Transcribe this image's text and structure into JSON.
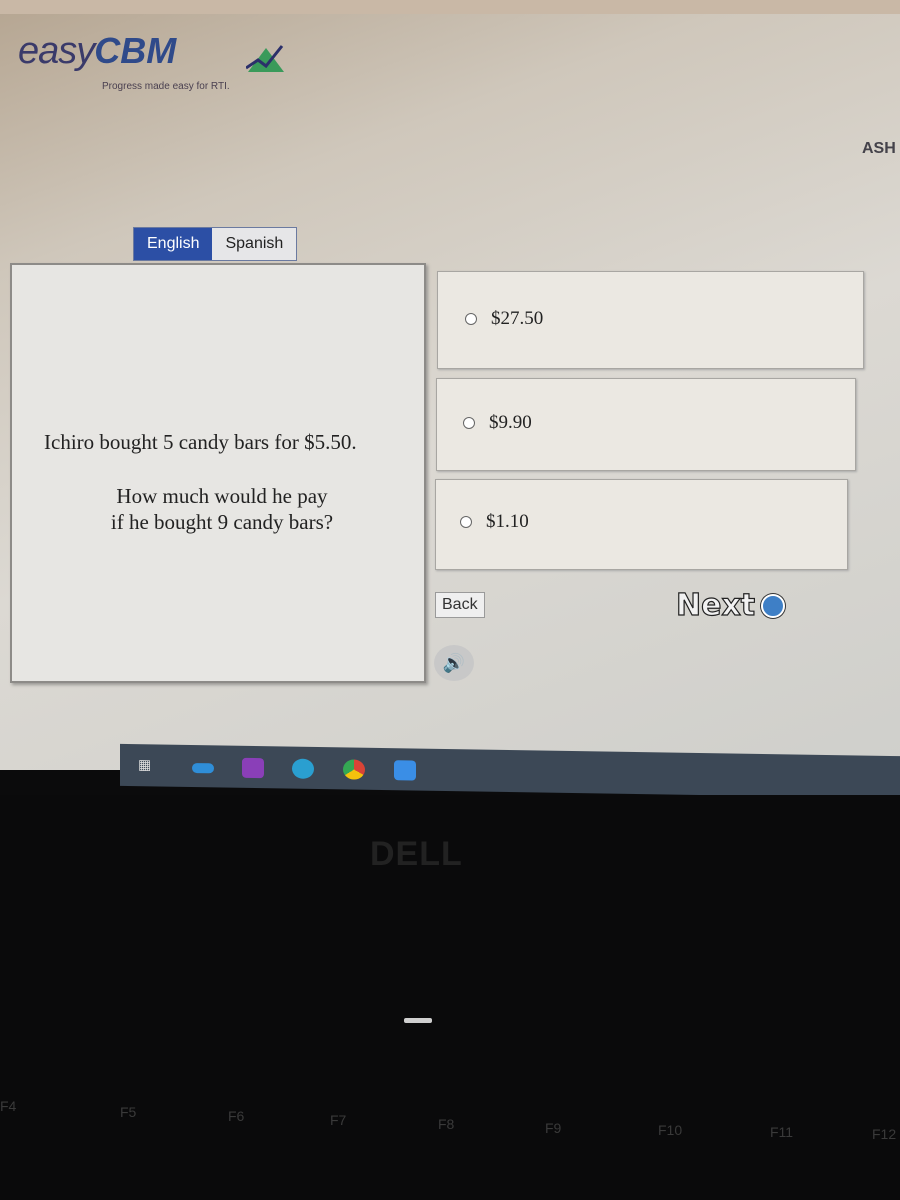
{
  "header": {
    "logo_easy": "easy",
    "logo_cbm": "CBM",
    "tagline": "Progress made easy for RTI.",
    "user_partial": "ASH"
  },
  "language_tabs": [
    {
      "label": "English",
      "active": true
    },
    {
      "label": "Spanish",
      "active": false
    }
  ],
  "question": {
    "line1": "Ichiro bought 5 candy bars for $5.50.",
    "line2": "How much would he pay",
    "line3": "if he bought 9 candy bars?"
  },
  "choices": [
    {
      "label": "$27.50",
      "selected": false
    },
    {
      "label": "$9.90",
      "selected": false
    },
    {
      "label": "$1.10",
      "selected": false
    }
  ],
  "nav": {
    "back": "Back",
    "next": "Next"
  },
  "taskbar": {
    "icons": [
      "task-view-icon",
      "onedrive-icon",
      "onenote-icon",
      "edge-icon",
      "chrome-icon",
      "zoom-icon"
    ]
  },
  "device": {
    "brand": "DELL",
    "keys": [
      "F4",
      "F5",
      "F6",
      "F7",
      "F8",
      "F9",
      "F10",
      "F11",
      "F12"
    ]
  },
  "colors": {
    "accent": "#2c4fa5",
    "logo_green": "#3a9a5a"
  }
}
